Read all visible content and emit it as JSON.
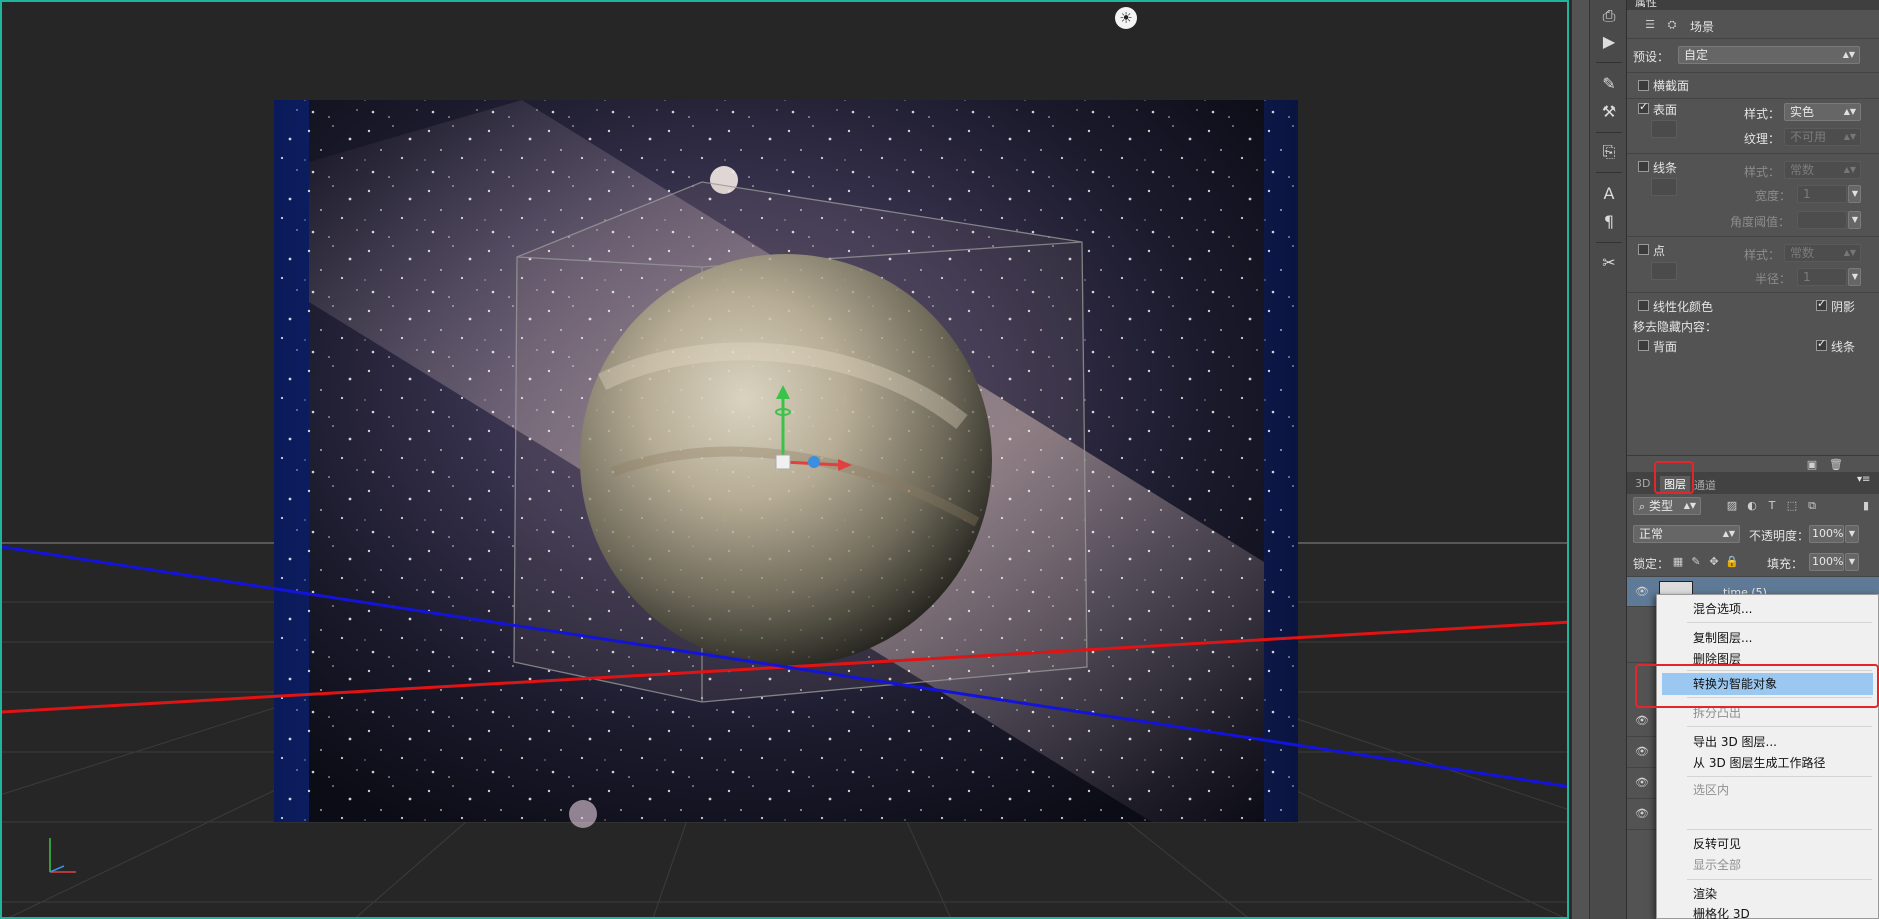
{
  "viewport": {
    "light_icon": "☀"
  },
  "toolstrip": {
    "icons": [
      "history-brush-icon",
      "play-icon",
      "brush-preset-icon",
      "adjust-icon",
      "clone-source-icon",
      "character-icon",
      "paragraph-icon",
      "tool-presets-icon"
    ]
  },
  "properties": {
    "header_title": "属性",
    "mode_tab": "场景",
    "preset_label": "预设：",
    "preset_value": "自定",
    "cross_section_label": "横截面",
    "surface_label": "表面",
    "surface_checked": true,
    "surface_style_label": "样式：",
    "surface_style_value": "实色",
    "surface_texture_label": "纹理：",
    "surface_texture_value": "不可用",
    "lines_label": "线条",
    "lines_style_label": "样式：",
    "lines_style_value": "常数",
    "lines_width_label": "宽度：",
    "lines_width_value": "1",
    "lines_angle_label": "角度阈值：",
    "points_label": "点",
    "points_style_label": "样式：",
    "points_style_value": "常数",
    "points_radius_label": "半径：",
    "points_radius_value": "1",
    "linearize_label": "线性化颜色",
    "shadow_label": "阴影",
    "remove_hidden_label": "移去隐藏内容：",
    "backface_label": "背面",
    "lines2_label": "线条"
  },
  "layers_panel": {
    "tabs": [
      "3D",
      "图层",
      "通道"
    ],
    "active_tab": "图层",
    "filter_label": "类型",
    "blend_mode": "正常",
    "opacity_label": "不透明度：",
    "opacity_value": "100%",
    "lock_label": "锁定：",
    "fill_label": "填充：",
    "fill_value": "100%",
    "layer_name": "time (5)"
  },
  "context_menu": {
    "items": [
      {
        "label": "混合选项...",
        "disabled": false
      },
      {
        "label": "复制图层...",
        "disabled": false
      },
      {
        "label": "删除图层",
        "disabled": false
      },
      {
        "label": "转换为智能对象",
        "disabled": false,
        "highlighted": true
      },
      {
        "label": "拆分凸出",
        "disabled": true
      },
      {
        "label": "导出 3D 图层...",
        "disabled": false
      },
      {
        "label": "从 3D 图层生成工作路径",
        "disabled": false
      },
      {
        "label": "选区内",
        "disabled": true
      },
      {
        "label": "反转可见",
        "disabled": false
      },
      {
        "label": "显示全部",
        "disabled": true
      },
      {
        "label": "渲染",
        "disabled": false
      },
      {
        "label": "栅格化 3D",
        "disabled": false
      }
    ]
  },
  "colors": {
    "accent_frame": "#1fb59a",
    "highlight_menu": "#9ac8f0",
    "annotation_red": "#e3262c",
    "axis_red": "#e01414",
    "axis_blue": "#1414d8"
  }
}
